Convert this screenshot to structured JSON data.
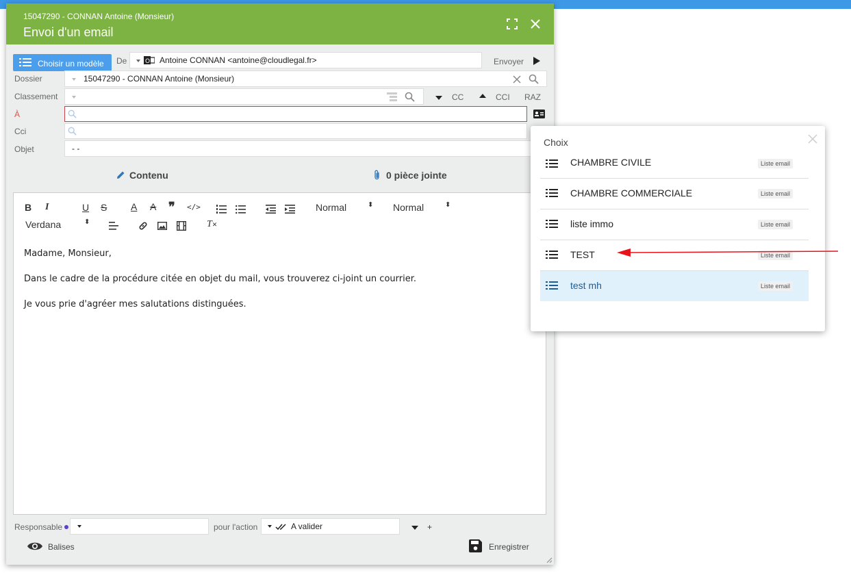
{
  "modal": {
    "subtitle": "15047290 - CONNAN Antoine (Monsieur)",
    "title": "Envoi d'un email"
  },
  "toolbar_top": {
    "model_button": "Choisir un modèle",
    "from_label": "De",
    "from_value": "Antoine CONNAN <antoine@cloudlegal.fr>",
    "send_label": "Envoyer"
  },
  "form": {
    "dossier_label": "Dossier",
    "dossier_value": "15047290 - CONNAN Antoine (Monsieur)",
    "classement_label": "Classement",
    "cc_label": "CC",
    "cci_toggle_label": "CCI",
    "raz_label": "RAZ",
    "to_label": "À",
    "to_value": "",
    "cci_label": "Cci",
    "cci_value": "",
    "objet_label": "Objet",
    "objet_value": "-  -"
  },
  "tabs": [
    {
      "label": "Contenu"
    },
    {
      "label": "0 pièce jointe"
    }
  ],
  "editor_toolbar": {
    "format1": "Normal",
    "format2": "Normal",
    "font": "Verdana"
  },
  "editor": {
    "paragraphs": [
      "Madame, Monsieur,",
      "Dans le cadre de la procédure citée en objet du mail, vous trouverez ci-joint un courrier.",
      "Je vous prie d'agréer mes salutations distinguées."
    ]
  },
  "footer": {
    "responsable_label": "Responsable",
    "action_label": "pour l'action",
    "action_value": "A valider",
    "plus": "+",
    "balises_label": "Balises",
    "save_label": "Enregistrer"
  },
  "popup": {
    "title": "Choix",
    "items": [
      {
        "name": "CHAMBRE CIVILE",
        "badge": "Liste email"
      },
      {
        "name": "CHAMBRE COMMERCIALE",
        "badge": "Liste email"
      },
      {
        "name": "liste immo",
        "badge": "Liste email"
      },
      {
        "name": "TEST",
        "badge": "Liste email"
      },
      {
        "name": "test mh",
        "badge": "Liste email"
      }
    ]
  },
  "colors": {
    "header_green": "#7cb342",
    "accent_blue": "#4a9eec",
    "arrow_red": "#e8141b",
    "selected_row": "#e1f1fb"
  }
}
